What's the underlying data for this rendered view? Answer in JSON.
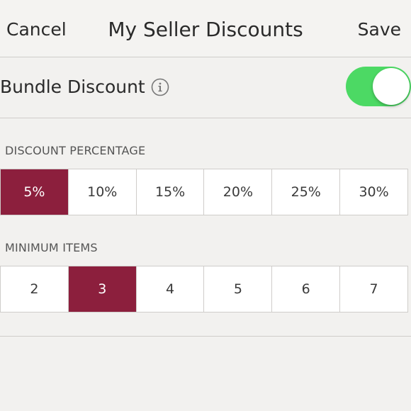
{
  "nav": {
    "cancel_label": "Cancel",
    "title": "My Seller Discounts",
    "save_label": "Save"
  },
  "bundle": {
    "label": "Bundle Discount",
    "info_icon": "info-icon",
    "toggle_on": true,
    "toggle_color": "#4cd964"
  },
  "discount_percentage": {
    "label": "DISCOUNT PERCENTAGE",
    "options": [
      "5%",
      "10%",
      "15%",
      "20%",
      "25%",
      "30%"
    ],
    "selected_index": 0
  },
  "minimum_items": {
    "label": "MINIMUM ITEMS",
    "options": [
      "2",
      "3",
      "4",
      "5",
      "6",
      "7"
    ],
    "selected_index": 1
  },
  "colors": {
    "accent": "#8c1f3d",
    "toggle_on": "#4cd964"
  }
}
